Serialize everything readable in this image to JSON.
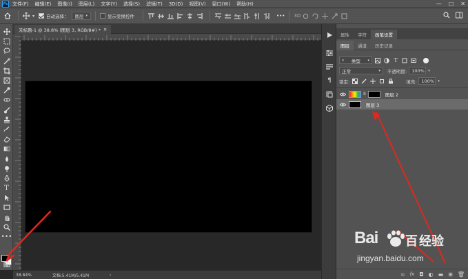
{
  "app": {
    "logo": "Ps"
  },
  "menu": [
    "文件(F)",
    "编辑(E)",
    "图像(I)",
    "图层(L)",
    "文字(Y)",
    "选择(S)",
    "滤镜(T)",
    "3D(D)",
    "视图(V)",
    "窗口(W)",
    "帮助(H)"
  ],
  "window_controls": [
    "—",
    "□",
    "✕"
  ],
  "options_bar": {
    "auto_select_label": "自动选择：",
    "auto_select_value": "图层",
    "show_transform_label": "显示变换控件",
    "more": "•••"
  },
  "document": {
    "tab_title": "未标题-1 @ 38.8% (图层 3, RGB/8#) *",
    "close": "✕",
    "canvas_color": "#000000"
  },
  "status": {
    "zoom": "38.84%",
    "doc_info": "文档:5.41M/5.41M",
    "arrow": "›"
  },
  "panel": {
    "top_tabs": [
      "属性",
      "字符",
      "画笔设置"
    ],
    "sub_tabs": [
      "图层",
      "通道",
      "历史记录"
    ],
    "filter_label": "类型",
    "blend_mode": "正常",
    "opacity_label": "不透明度:",
    "opacity_value": "100%",
    "lock_label": "锁定:",
    "fill_label": "填充:",
    "fill_value": "100%",
    "layers": [
      {
        "name": "图层 2",
        "thumb": "gradient",
        "selected": false
      },
      {
        "name": "图层 3",
        "thumb": "black",
        "selected": true
      }
    ],
    "bottom_icons": [
      "link-icon",
      "fx-icon",
      "mask-icon",
      "adjustment-icon",
      "folder-icon",
      "new-layer-icon",
      "trash-icon"
    ]
  },
  "watermark": {
    "brand": "Bai",
    "brand2": "百",
    "brand3": "经验",
    "url": "jingyan.baidu.com"
  },
  "colors": {
    "accent": "#31a8ff",
    "arrow": "#e0281e",
    "panel_bg": "#535353",
    "canvas_bg": "#282828"
  }
}
